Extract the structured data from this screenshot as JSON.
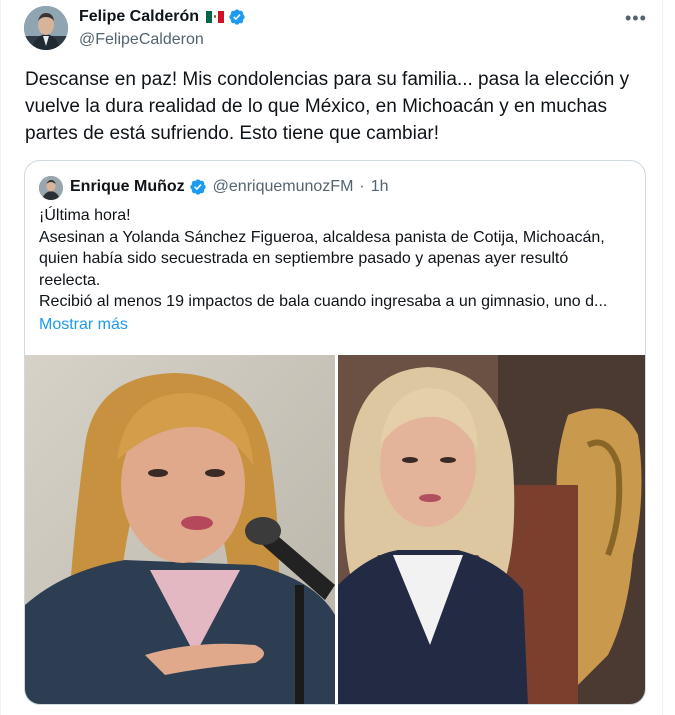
{
  "tweet": {
    "author_name": "Felipe Calderón",
    "author_flag": "flag-mexico-icon",
    "author_handle": "@FelipeCalderon",
    "more_label": "•••",
    "text": "Descanse en paz! Mis condolencias para su familia... pasa la elección y vuelve la dura realidad de lo que México, en Michoacán y en muchas partes de está sufriendo. Esto tiene que cambiar!"
  },
  "quote": {
    "author_name": "Enrique Muñoz",
    "author_handle": "@enriquemunozFM",
    "separator": "·",
    "time": "1h",
    "lines": [
      "¡Última hora!",
      "Asesinan a Yolanda Sánchez Figueroa, alcaldesa panista de Cotija, Michoacán,",
      "quien había sido secuestrada en septiembre pasado y apenas ayer resultó",
      "reelecta.",
      "Recibió al menos 19 impactos de bala cuando ingresaba a un gimnasio, uno d..."
    ],
    "show_more": "Mostrar más",
    "images": [
      "woman-speaking-at-microphone-photo",
      "woman-portrait-photo"
    ]
  },
  "colors": {
    "verified": "#1d9bf0",
    "link": "#1d9bf0",
    "text": "#0f1419",
    "secondary": "#536471",
    "border": "#cfd9de"
  }
}
